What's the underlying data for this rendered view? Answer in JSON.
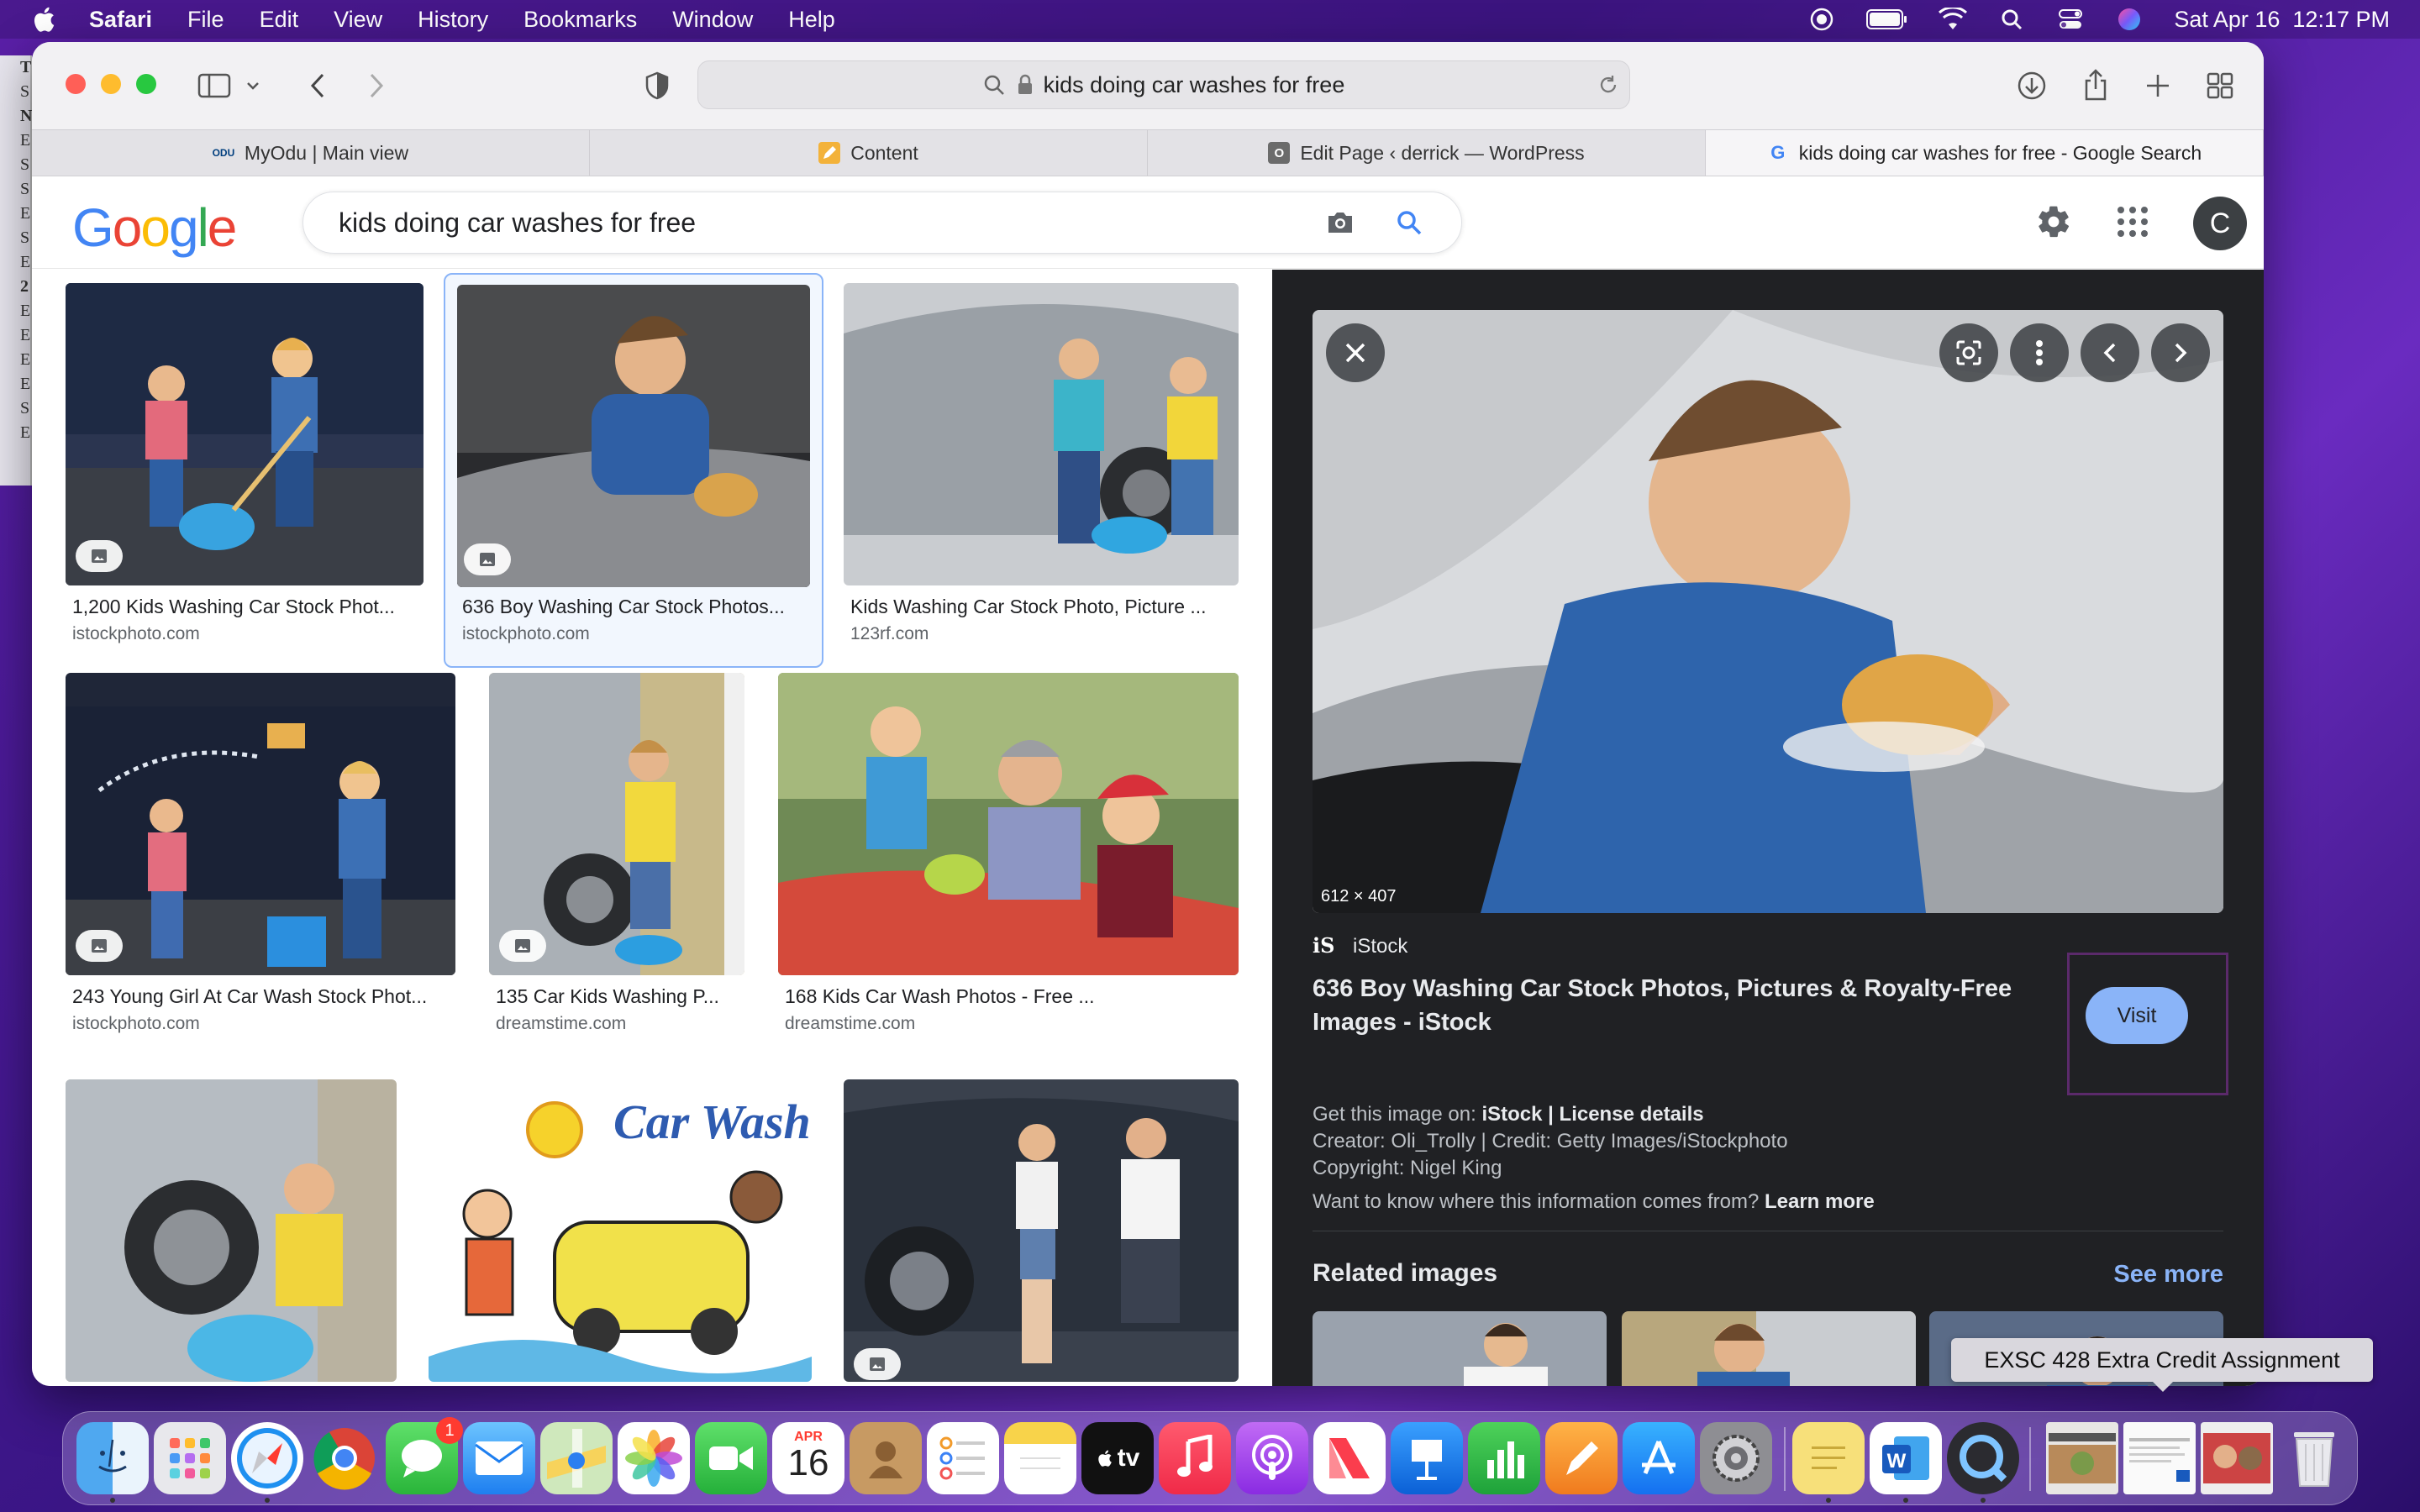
{
  "menubar": {
    "app_name": "Safari",
    "items": [
      "File",
      "Edit",
      "View",
      "History",
      "Bookmarks",
      "Window",
      "Help"
    ],
    "clock": "Sat Apr 16  12:17 PM"
  },
  "browser": {
    "url": "kids doing car washes for free",
    "tabs": [
      {
        "label": "MyOdu | Main view",
        "favicon": "ODU"
      },
      {
        "label": "Content",
        "favicon": "pencil"
      },
      {
        "label": "Edit Page ‹ derrick — WordPress",
        "favicon": "O"
      },
      {
        "label": "kids doing car washes for free - Google Search",
        "favicon": "G"
      }
    ]
  },
  "google": {
    "logo": "Google",
    "query": "kids doing car washes for free",
    "avatar_letter": "C"
  },
  "results": [
    {
      "title": "1,200 Kids Washing Car Stock Phot...",
      "source": "istockphoto.com"
    },
    {
      "title": "636 Boy Washing Car Stock Photos...",
      "source": "istockphoto.com"
    },
    {
      "title": "Kids Washing Car Stock Photo, Picture ...",
      "source": "123rf.com"
    },
    {
      "title": "243 Young Girl At Car Wash Stock Phot...",
      "source": "istockphoto.com"
    },
    {
      "title": "135 Car Kids Washing P...",
      "source": "dreamstime.com"
    },
    {
      "title": "168 Kids Car Wash Photos - Free ...",
      "source": "dreamstime.com"
    },
    {
      "title": "",
      "source": ""
    },
    {
      "title": "",
      "source": "",
      "art_text": "Car Wash"
    },
    {
      "title": "",
      "source": ""
    }
  ],
  "preview": {
    "dimensions": "612 × 407",
    "source_name": "iStock",
    "source_logo": "iS",
    "title": "636 Boy Washing Car Stock Photos, Pictures & Royalty-Free Images - iStock",
    "visit_label": "Visit",
    "get_image_prefix": "Get this image on: ",
    "get_image_site": "iStock",
    "license_sep": " | ",
    "license_details": "License details",
    "creator": "Creator: Oli_Trolly | Credit: Getty Images/iStockphoto",
    "copyright": "Copyright: Nigel King",
    "info_prefix": "Want to know where this information comes from? ",
    "learn_more": "Learn more",
    "related_heading": "Related images",
    "see_more": "See more"
  },
  "desktop_doc_letters": [
    "T",
    "S",
    "N",
    "E",
    "S",
    "S",
    "E",
    "S",
    "E",
    "2",
    "E",
    "E",
    "E",
    "E",
    "S",
    "E"
  ],
  "tooltip": "EXSC 428 Extra Credit Assignment",
  "dock": {
    "messages_badge": "1",
    "calendar_month": "APR",
    "calendar_day": "16",
    "tv_label": "tv"
  },
  "colors": {
    "google_blue": "#4285F4",
    "google_red": "#EA4335",
    "google_yellow": "#FBBC05",
    "google_green": "#34A853",
    "visit_button": "#8ab4f8",
    "preview_bg": "#202124"
  }
}
